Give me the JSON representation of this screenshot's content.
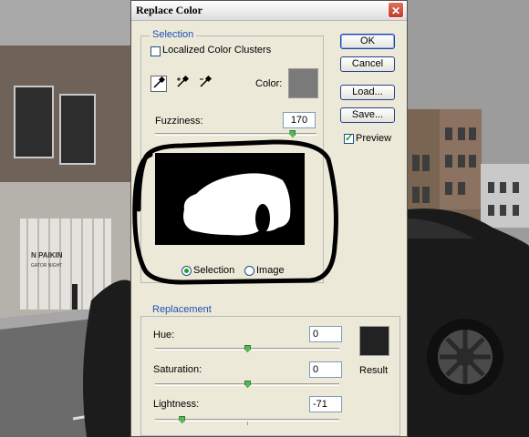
{
  "dialog": {
    "title": "Replace Color",
    "close_label": "✕",
    "buttons": {
      "ok": "OK",
      "cancel": "Cancel",
      "load": "Load...",
      "save": "Save..."
    },
    "preview": {
      "label": "Preview",
      "checked": true
    }
  },
  "selection": {
    "group_label": "Selection",
    "localized_label": "Localized Color Clusters",
    "localized_checked": false,
    "tools": [
      "eyedropper-icon",
      "eyedropper-plus-icon",
      "eyedropper-minus-icon"
    ],
    "color_label": "Color:",
    "color_value": "#7a7a7a",
    "fuzziness_label": "Fuzziness:",
    "fuzziness_value": "170",
    "fuzziness_level": 0.85,
    "radio_selection": "Selection",
    "radio_image": "Image",
    "selected_radio": "Selection"
  },
  "replacement": {
    "group_label": "Replacement",
    "hue_label": "Hue:",
    "hue_value": "0",
    "hue_level": 0.5,
    "saturation_label": "Saturation:",
    "saturation_value": "0",
    "saturation_level": 0.5,
    "lightness_label": "Lightness:",
    "lightness_value": "-71",
    "lightness_level": 0.145,
    "result_label": "Result",
    "result_color": "#222222"
  },
  "background": {
    "sign_line1": "N  PAIKIN",
    "sign_line2": "GATOR NIGHT"
  }
}
